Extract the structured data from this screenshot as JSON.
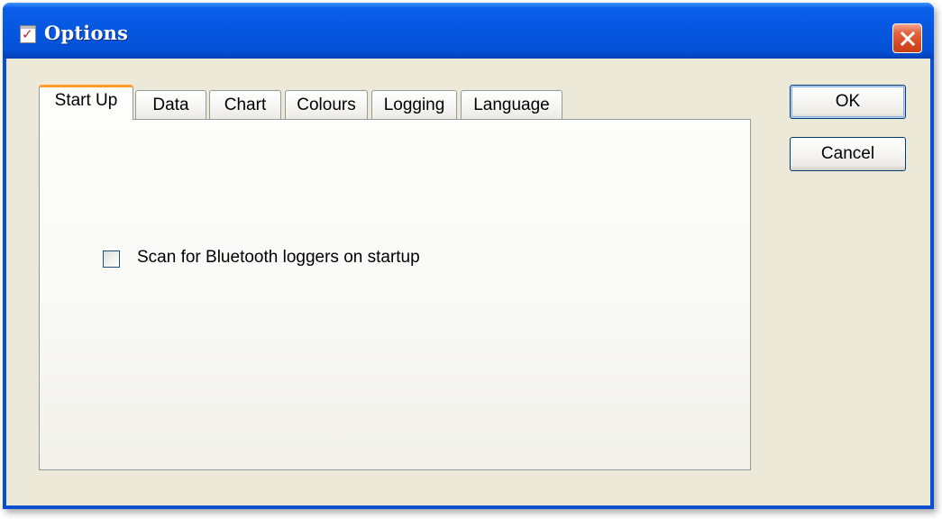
{
  "window": {
    "title": "Options",
    "icon": "checklist-icon",
    "close_icon": "close-icon"
  },
  "tabs": [
    {
      "label": "Start Up",
      "active": true
    },
    {
      "label": "Data",
      "active": false
    },
    {
      "label": "Chart",
      "active": false
    },
    {
      "label": "Colours",
      "active": false
    },
    {
      "label": "Logging",
      "active": false
    },
    {
      "label": "Language",
      "active": false
    }
  ],
  "startup": {
    "scan_bluetooth_label": "Scan for Bluetooth loggers on startup",
    "scan_bluetooth_checked": false
  },
  "buttons": {
    "ok_label": "OK",
    "cancel_label": "Cancel"
  },
  "colors": {
    "title_bar": "#0657e0",
    "client_background": "#ece9d8",
    "active_tab_accent": "#ff9c2a",
    "close_button": "#d54a22"
  }
}
